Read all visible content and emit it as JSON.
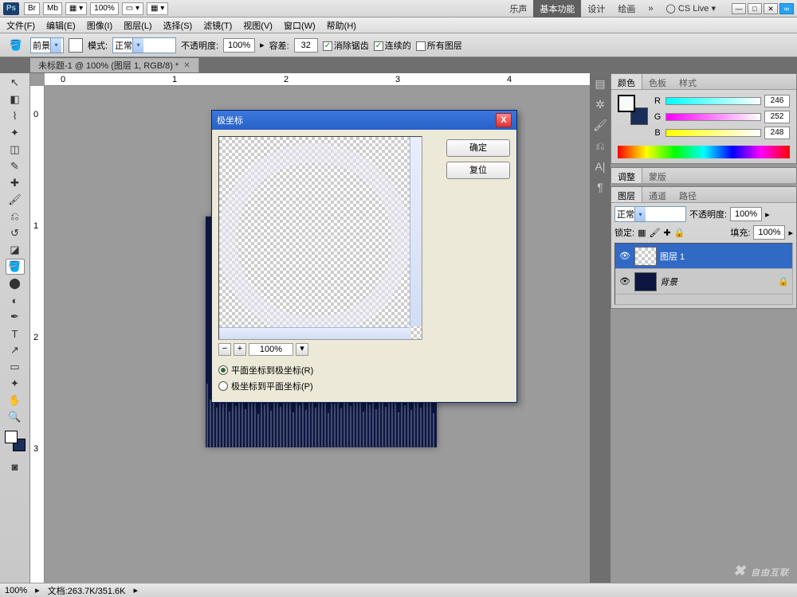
{
  "header": {
    "app": "Ps",
    "zoom": "100%",
    "tabs": [
      "乐声",
      "基本功能",
      "设计",
      "绘画"
    ],
    "active_tab": "基本功能",
    "cslive": "CS Live"
  },
  "menu": [
    "文件(F)",
    "编辑(E)",
    "图像(I)",
    "图层(L)",
    "选择(S)",
    "滤镜(T)",
    "视图(V)",
    "窗口(W)",
    "帮助(H)"
  ],
  "options": {
    "fill": "前景",
    "mode_label": "模式:",
    "mode_value": "正常",
    "opacity_label": "不透明度:",
    "opacity_value": "100%",
    "tolerance_label": "容差:",
    "tolerance_value": "32",
    "antialias": "消除锯齿",
    "contiguous": "连续的",
    "all_layers": "所有图层"
  },
  "doc_tab": "未标题-1 @ 100% (图层 1, RGB/8) *",
  "ruler_h": [
    "0",
    "1",
    "2",
    "3",
    "4"
  ],
  "ruler_v": [
    "0",
    "1",
    "2",
    "3"
  ],
  "color_panel": {
    "tabs": [
      "颜色",
      "色板",
      "样式"
    ],
    "r_label": "R",
    "r_val": "246",
    "g_label": "G",
    "g_val": "252",
    "b_label": "B",
    "b_val": "248"
  },
  "adjust_tabs": [
    "调整",
    "蒙版"
  ],
  "layers_panel": {
    "tabs": [
      "图层",
      "通道",
      "路径"
    ],
    "blend": "正常",
    "opacity_label": "不透明度:",
    "opacity": "100%",
    "lock_label": "锁定:",
    "fill_label": "填充:",
    "fill": "100%",
    "layers": [
      {
        "name": "图层 1",
        "bg": false,
        "selected": true
      },
      {
        "name": "背景",
        "bg": true,
        "selected": false
      }
    ]
  },
  "dialog": {
    "title": "极坐标",
    "ok": "确定",
    "cancel": "复位",
    "zoom": "100%",
    "opt1": "平面坐标到极坐标(R)",
    "opt2": "极坐标到平面坐标(P)"
  },
  "status": {
    "zoom": "100%",
    "doc": "文档:263.7K/351.6K"
  },
  "watermark": "自由互联"
}
